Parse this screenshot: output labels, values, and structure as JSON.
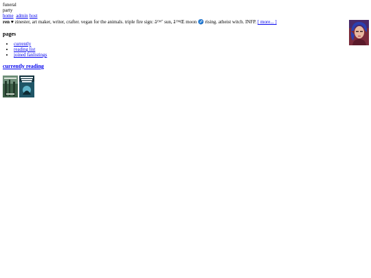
{
  "header": {
    "title_line1": "funeral",
    "title_line2": "party",
    "nav": [
      "home",
      "admin",
      "host"
    ]
  },
  "about": {
    "name": "ren",
    "heart": "♥",
    "bio": " zinester, art maker, writer, crafter. vegan for the animals. triple fire sign: â™ˆ️ sun, â™Œ️ moon ♐️ rising. atheist witch. INFP. ",
    "more_link": "[ more... ]"
  },
  "pages": {
    "heading": "pages",
    "items": [
      "currently",
      "reading list",
      "joined fanlistings"
    ]
  },
  "currently_reading": {
    "heading": "currently reading"
  },
  "colors": {
    "link": "#0000ee",
    "book1": "#3d5e47",
    "book2": "#1f5566",
    "avatar_bg": "#7a2b3b",
    "avatar_hair": "#2b3fb0"
  }
}
